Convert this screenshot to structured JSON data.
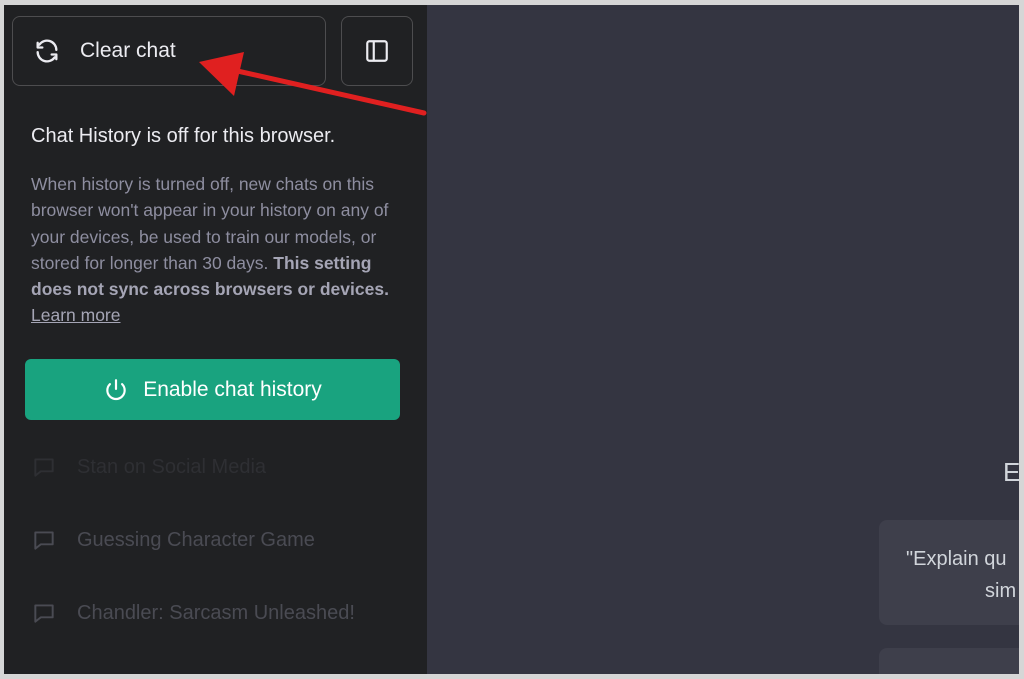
{
  "sidebar": {
    "clear_chat_label": "Clear chat",
    "notice": {
      "title": "Chat History is off for this browser.",
      "body_plain": "When history is turned off, new chats on this browser won't appear in your history on any of your devices, be used to train our models, or stored for longer than 30 days.",
      "body_bold": "This setting does not sync across browsers or devices.",
      "link": "Learn more"
    },
    "enable_label": "Enable chat history",
    "history": [
      {
        "title": "Stan on Social Media"
      },
      {
        "title": "Guessing Character Game"
      },
      {
        "title": "Chandler: Sarcasm Unleashed!"
      }
    ]
  },
  "main": {
    "partial_heading": "E",
    "example_card_lines": [
      "\"Explain qu",
      "sim"
    ]
  },
  "colors": {
    "sidebar_bg": "#202123",
    "main_bg": "#343541",
    "accent": "#19a37f",
    "annotation_arrow": "#e02020"
  },
  "icons": [
    "refresh-icon",
    "sidebar-toggle-icon",
    "power-icon",
    "chat-bubble-icon",
    "red-arrow-annotation"
  ]
}
